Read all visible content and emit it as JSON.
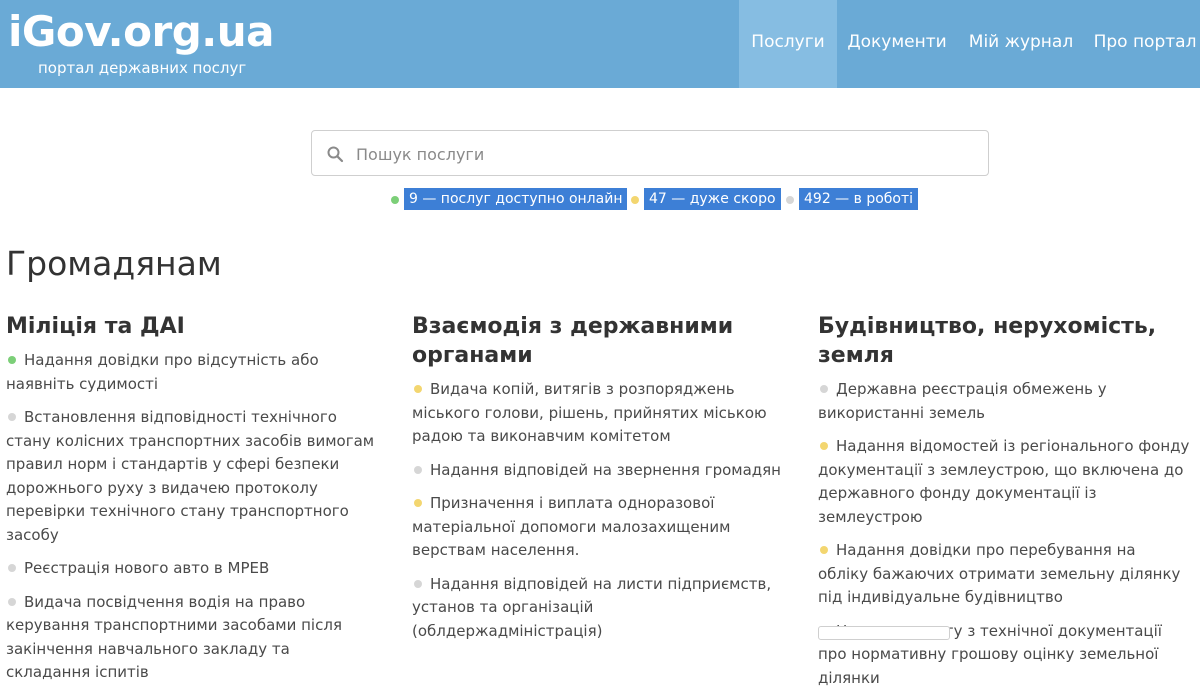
{
  "header": {
    "logo": "iGov.org.ua",
    "tagline": "портал державних послуг",
    "nav": [
      {
        "label": "Послуги",
        "active": true
      },
      {
        "label": "Документи",
        "active": false
      },
      {
        "label": "Мій журнал",
        "active": false
      },
      {
        "label": "Про портал",
        "active": false
      }
    ]
  },
  "search": {
    "placeholder": "Пошук послуги",
    "value": "",
    "icon": "search-icon"
  },
  "stats": [
    {
      "text": "9 — послуг доступно онлайн",
      "color": "#7ccf78"
    },
    {
      "text": "47 — дуже скоро",
      "color": "#f3d670"
    },
    {
      "text": "492 — в роботі",
      "color": "#d6d6d6"
    }
  ],
  "section_title": "Громадянам",
  "columns": [
    {
      "title": "Міліція та ДАІ",
      "items": [
        {
          "text": "Надання довідки про відсутність або наявніть судимості",
          "status": "green"
        },
        {
          "text": "Встановлення відповідності технічного стану колісних транспортних засобів вимогам правил норм і стандартів у сфері безпеки дорожнього руху з видачею протоколу перевірки технічного стану транспортного засобу",
          "status": "gray"
        },
        {
          "text": "Реєстрація нового авто в МРЕВ",
          "status": "gray"
        },
        {
          "text": "Видача посвідчення водія на право керування транспортними засобами після закінчення навчального закладу та складання іспитів",
          "status": "gray"
        }
      ]
    },
    {
      "title": "Взаємодія з державними органами",
      "items": [
        {
          "text": "Видача копій, витягів з розпоряджень міського голови, рішень, прийнятих міською радою та виконавчим комітетом",
          "status": "yellow"
        },
        {
          "text": "Надання відповідей на звернення громадян",
          "status": "gray"
        },
        {
          "text": "Призначення і виплата одноразової матеріальної допомоги малозахищеним верствам населення.",
          "status": "yellow"
        },
        {
          "text": "Надання відповідей на листи підприємств, установ та організацій (облдержадміністрація)",
          "status": "gray"
        }
      ]
    },
    {
      "title": "Будівництво, нерухомість, земля",
      "items": [
        {
          "text": "Державна реєстрація обмежень у використанні земель",
          "status": "gray"
        },
        {
          "text": "Надання відомостей із регіонального фонду документації з землеустрою, що включена до державного фонду документації із землеустрою",
          "status": "yellow"
        },
        {
          "text": "Надання довідки про перебування на обліку бажаючих отримати земельну ділянку під індивідуальне будівництво",
          "status": "yellow"
        },
        {
          "text": "Надання витягу з технічної документації про нормативну грошову оцінку земельної ділянки",
          "status": "yellow"
        }
      ]
    }
  ]
}
